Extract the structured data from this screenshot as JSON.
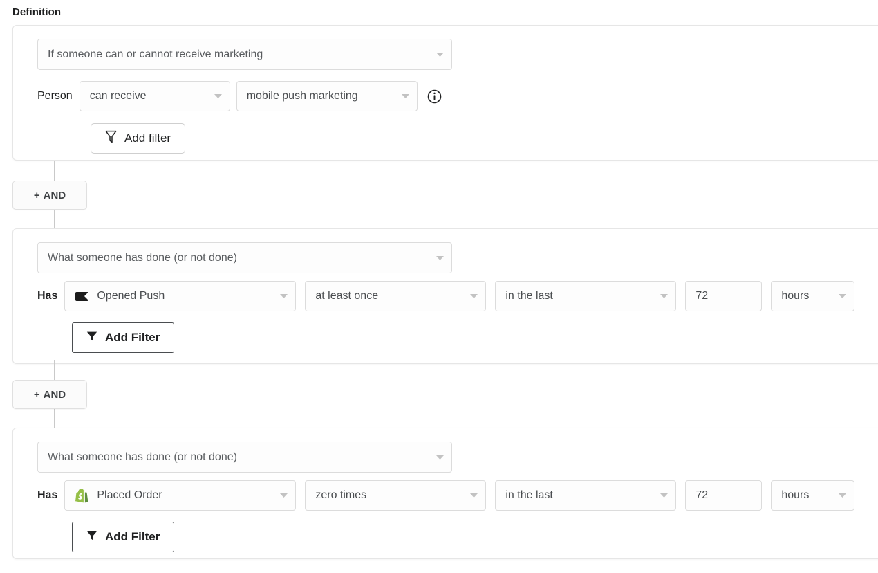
{
  "header": {
    "title": "Definition"
  },
  "icons": {
    "caret": "chevron-down-icon",
    "info": "info-circle-icon",
    "filter_outline": "filter-outline-icon",
    "filter_solid": "filter-solid-icon",
    "push": "push-notification-icon",
    "shopify": "shopify-icon"
  },
  "connectors": [
    {
      "label": "+ AND",
      "plus": "+",
      "text": "AND"
    },
    {
      "label": "+ AND",
      "plus": "+",
      "text": "AND"
    }
  ],
  "blocks": [
    {
      "id": "block-1",
      "type_select": "If someone can or cannot receive marketing",
      "prefix": "Person",
      "fields": [
        {
          "name": "consent-state-select",
          "value": "can receive"
        },
        {
          "name": "channel-select",
          "value": "mobile push marketing"
        }
      ],
      "has_info_icon": true,
      "add_filter_label": "Add filter"
    },
    {
      "id": "block-2",
      "type_select": "What someone has done (or not done)",
      "prefix": "Has",
      "metric": "Opened Push",
      "metric_icon": "push-notification-icon",
      "frequency": "at least once",
      "timeframe": "in the last",
      "amount": "72",
      "unit": "hours",
      "add_filter_label": "Add Filter"
    },
    {
      "id": "block-3",
      "type_select": "What someone has done (or not done)",
      "prefix": "Has",
      "metric": "Placed Order",
      "metric_icon": "shopify-icon",
      "frequency": "zero times",
      "timeframe": "in the last",
      "amount": "72",
      "unit": "hours",
      "add_filter_label": "Add Filter"
    }
  ],
  "colors": {
    "page_bg": "#ffffff",
    "card_border": "#e6e6e6",
    "text_primary": "#1f2021",
    "text_secondary": "#4a4d50",
    "shopify_green": "#95BF47"
  }
}
